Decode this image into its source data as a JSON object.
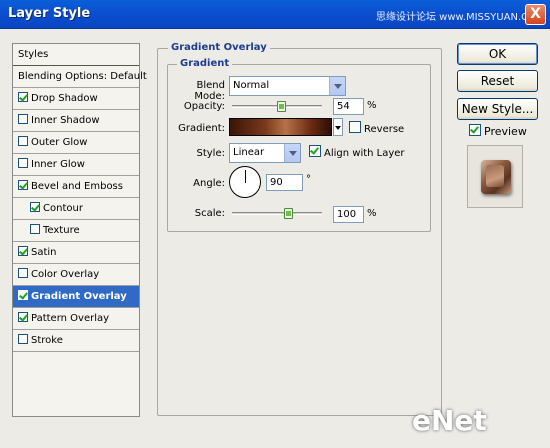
{
  "window": {
    "title": "Layer Style",
    "watermark": "思缘设计论坛 www.MISSYUAN.COM",
    "close_glyph": "X"
  },
  "styles_list": {
    "header": "Styles",
    "blending_options": "Blending Options: Default",
    "items": [
      {
        "label": "Drop Shadow",
        "checked": true,
        "indent": false
      },
      {
        "label": "Inner Shadow",
        "checked": false,
        "indent": false
      },
      {
        "label": "Outer Glow",
        "checked": false,
        "indent": false
      },
      {
        "label": "Inner Glow",
        "checked": false,
        "indent": false
      },
      {
        "label": "Bevel and Emboss",
        "checked": true,
        "indent": false
      },
      {
        "label": "Contour",
        "checked": true,
        "indent": true
      },
      {
        "label": "Texture",
        "checked": false,
        "indent": true
      },
      {
        "label": "Satin",
        "checked": true,
        "indent": false
      },
      {
        "label": "Color Overlay",
        "checked": false,
        "indent": false
      },
      {
        "label": "Gradient Overlay",
        "checked": true,
        "indent": false,
        "selected": true
      },
      {
        "label": "Pattern Overlay",
        "checked": true,
        "indent": false
      },
      {
        "label": "Stroke",
        "checked": false,
        "indent": false
      }
    ]
  },
  "gradient_overlay": {
    "group_title": "Gradient Overlay",
    "subgroup_title": "Gradient",
    "blend_mode_label": "Blend Mode:",
    "blend_mode_value": "Normal",
    "opacity_label": "Opacity:",
    "opacity_value": "54",
    "opacity_unit": "%",
    "opacity_fraction": 0.54,
    "gradient_label": "Gradient:",
    "reverse_label": "Reverse",
    "reverse_checked": false,
    "style_label": "Style:",
    "style_value": "Linear",
    "align_label": "Align with Layer",
    "align_checked": true,
    "angle_label": "Angle:",
    "angle_value": "90",
    "angle_unit": "°",
    "scale_label": "Scale:",
    "scale_value": "100",
    "scale_unit": "%"
  },
  "buttons": {
    "ok": "OK",
    "reset": "Reset",
    "new_style": "New Style...",
    "preview_label": "Preview",
    "preview_checked": true
  },
  "colors": {
    "titlebar": "#0a50d0",
    "selection": "#316ac5",
    "legend_text": "#1c3c8c"
  },
  "watermark_bottom": "eNet"
}
